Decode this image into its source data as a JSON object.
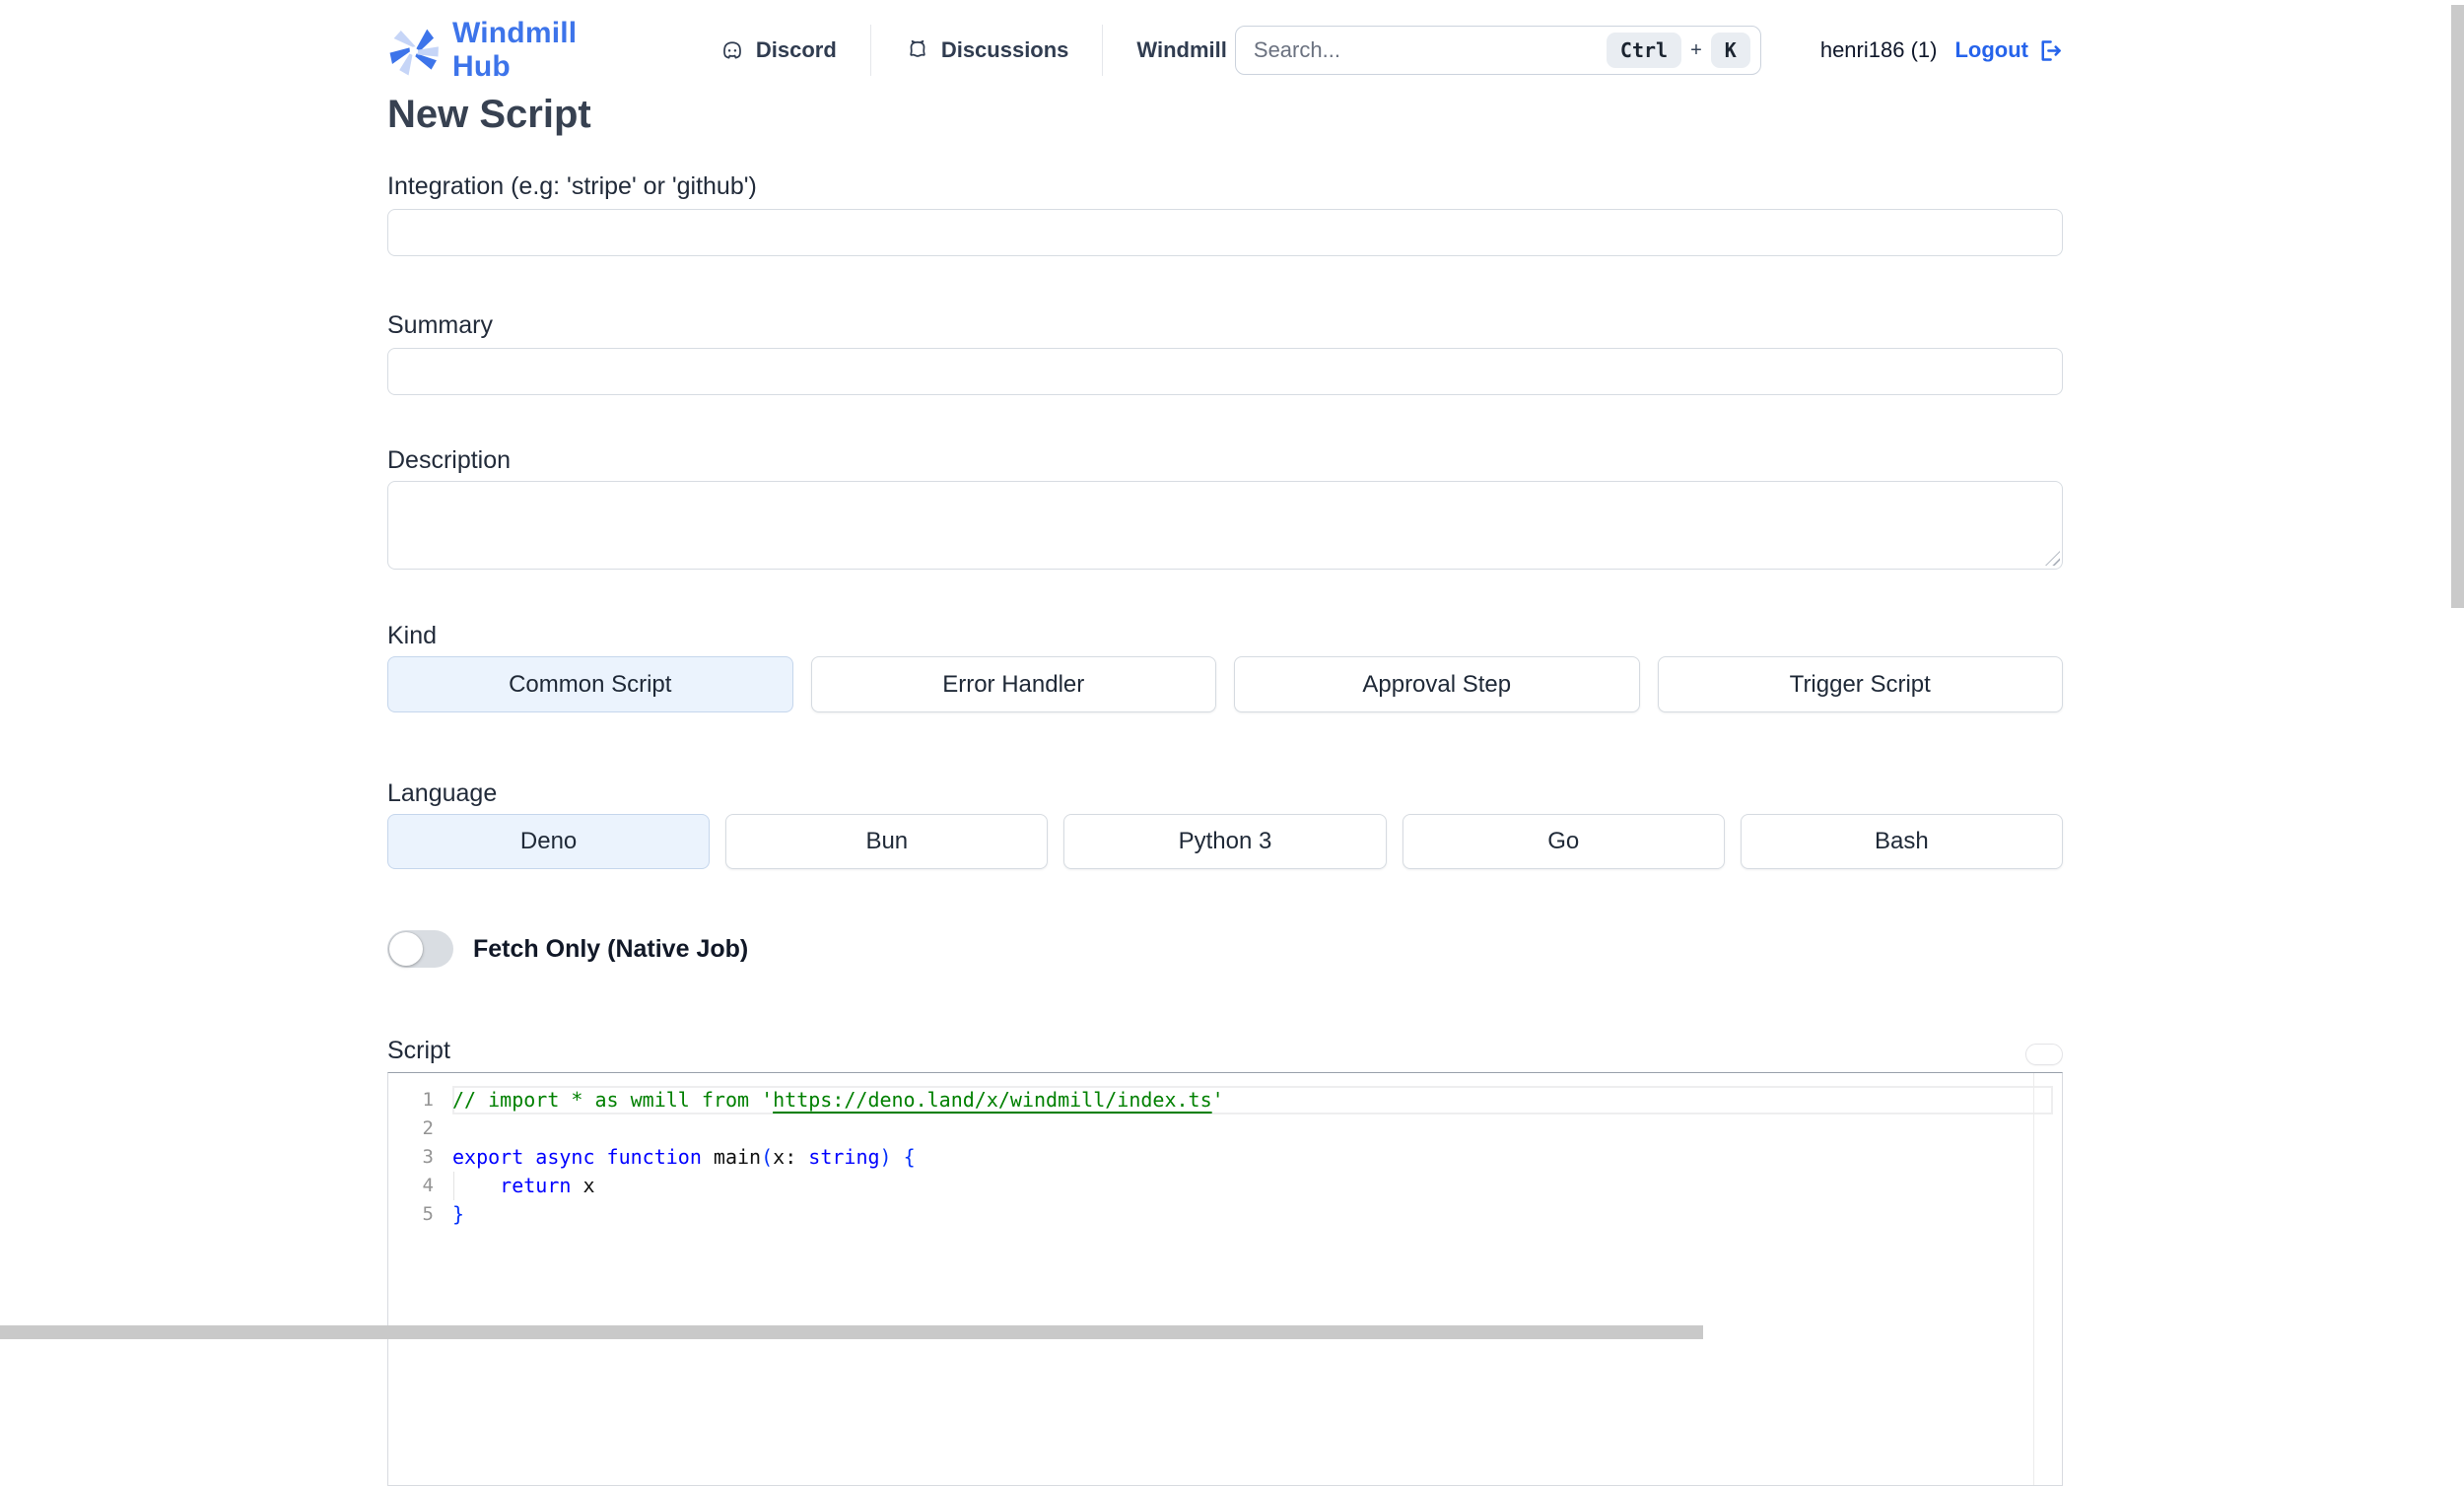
{
  "header": {
    "brand": "Windmill Hub",
    "nav": [
      {
        "label": "Discord"
      },
      {
        "label": "Discussions"
      },
      {
        "label": "Windmill"
      }
    ],
    "search": {
      "placeholder": "Search...",
      "kbd": [
        "Ctrl",
        "+",
        "K"
      ]
    },
    "user": {
      "name": "henri186 (1)",
      "logout_label": "Logout"
    }
  },
  "page_title": "New Script",
  "fields": {
    "integration": {
      "label": "Integration (e.g: 'stripe' or 'github')",
      "value": ""
    },
    "summary": {
      "label": "Summary",
      "value": ""
    },
    "description": {
      "label": "Description",
      "value": ""
    }
  },
  "kind": {
    "label": "Kind",
    "options": [
      {
        "label": "Common Script",
        "selected": true
      },
      {
        "label": "Error Handler",
        "selected": false
      },
      {
        "label": "Approval Step",
        "selected": false
      },
      {
        "label": "Trigger Script",
        "selected": false
      }
    ]
  },
  "language": {
    "label": "Language",
    "options": [
      {
        "label": "Deno",
        "selected": true
      },
      {
        "label": "Bun",
        "selected": false
      },
      {
        "label": "Python 3",
        "selected": false
      },
      {
        "label": "Go",
        "selected": false
      },
      {
        "label": "Bash",
        "selected": false
      }
    ]
  },
  "fetch_only": {
    "label": "Fetch Only (Native Job)",
    "enabled": false
  },
  "script_editor": {
    "label": "Script",
    "lines": [
      {
        "num": "1",
        "tokens": [
          "// import * as wmill from '",
          "https://deno.land/x/windmill/index.ts",
          "'"
        ]
      },
      {
        "num": "2",
        "tokens": []
      },
      {
        "num": "3",
        "tokens": [
          "export async function",
          " main",
          "(",
          "x",
          ": ",
          "string",
          ") {"
        ]
      },
      {
        "num": "4",
        "tokens": [
          "    ",
          "return",
          " x"
        ]
      },
      {
        "num": "5",
        "tokens": [
          "}"
        ]
      }
    ]
  },
  "colors": {
    "accent_blue": "#2563eb",
    "brand_blue": "#3d74ea",
    "selected_bg": "#ebf3fd",
    "comment_green": "#008000",
    "keyword_blue": "#0000ff"
  }
}
